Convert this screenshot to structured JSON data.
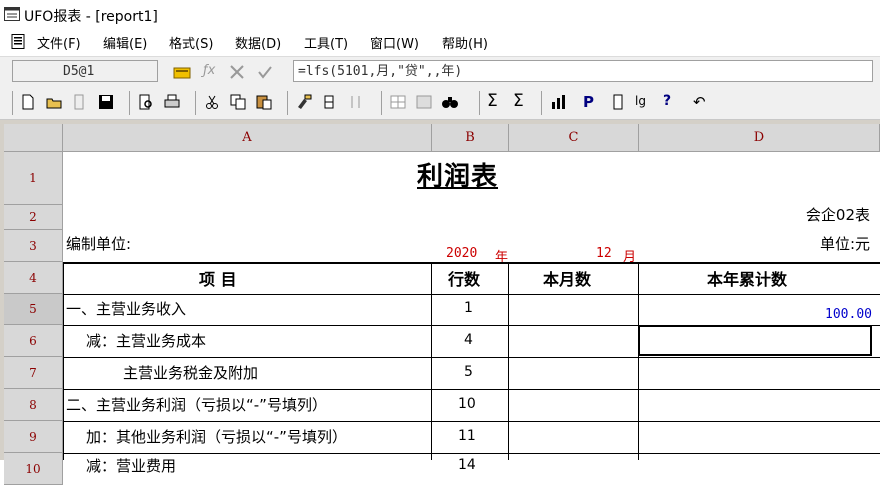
{
  "window": {
    "title": "UFO报表 - [report1]"
  },
  "menu": [
    "文件(F)",
    "编辑(E)",
    "格式(S)",
    "数据(D)",
    "工具(T)",
    "窗口(W)",
    "帮助(H)"
  ],
  "formula_bar": {
    "cell_ref": "D5@1",
    "formula": "=lfs(5101,月,\"贷\",,年)"
  },
  "columns": [
    "A",
    "B",
    "C",
    "D"
  ],
  "rows": [
    "1",
    "2",
    "3",
    "4",
    "5",
    "6",
    "7",
    "8",
    "9",
    "10"
  ],
  "sheet": {
    "title": "利润表",
    "form_code": "会企02表",
    "unit_label": "编制单位:",
    "currency_unit": "单位:元",
    "year": "2020",
    "year_suffix": "年",
    "month": "12",
    "month_suffix": "月",
    "headers": {
      "item": "项        目",
      "line": "行数",
      "this_month": "本月数",
      "ytd": "本年累计数"
    },
    "items": [
      {
        "name": "一、主营业务收入",
        "line": "1",
        "ytd": "100.00"
      },
      {
        "name": "减：主营业务成本",
        "line": "4",
        "ytd": ""
      },
      {
        "name": "主营业务税金及附加",
        "line": "5",
        "ytd": ""
      },
      {
        "name": "二、主营业务利润（亏损以“-”号填列）",
        "line": "10",
        "ytd": ""
      },
      {
        "name": "加：其他业务利润（亏损以“-”号填列）",
        "line": "11",
        "ytd": ""
      },
      {
        "name": "减：营业费用",
        "line": "14",
        "ytd": ""
      }
    ]
  },
  "colors": {
    "accent_red": "#cc0000",
    "value_blue": "#0000cc",
    "header_red": "#8b0000"
  }
}
